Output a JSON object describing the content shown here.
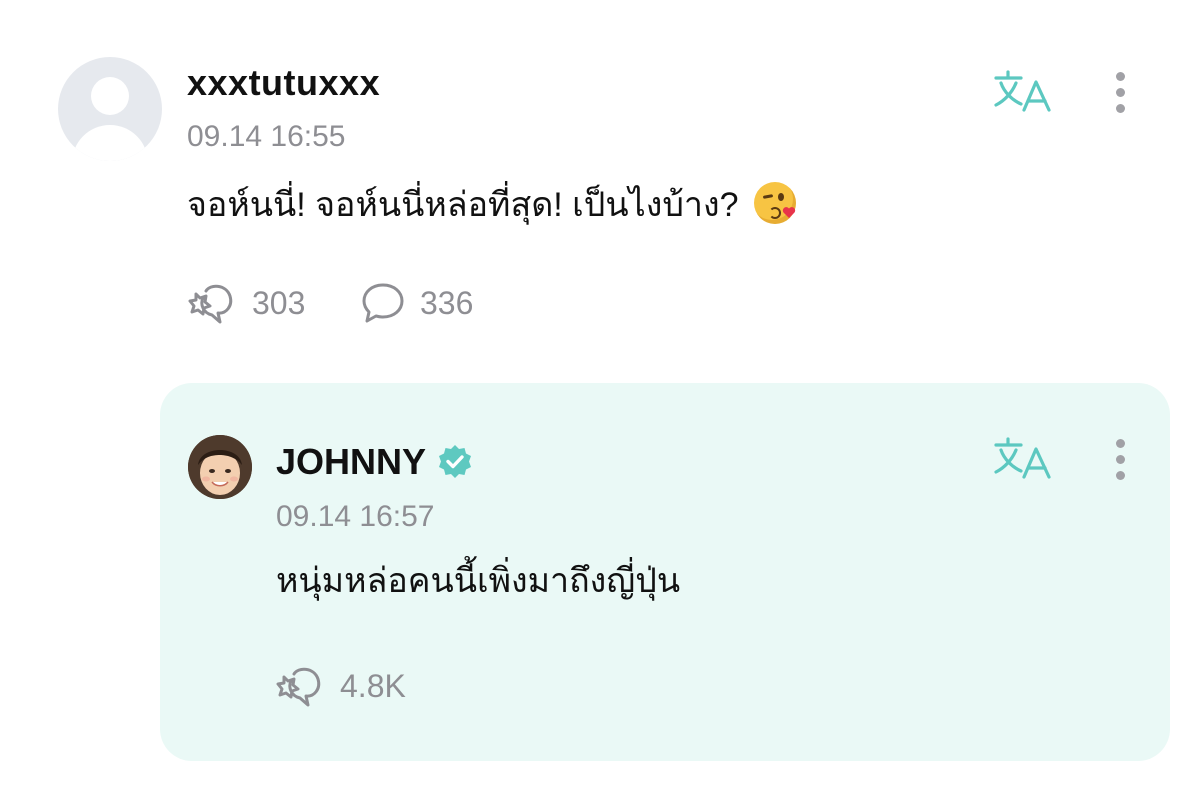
{
  "comment": {
    "username": "xxxtutuxxx",
    "timestamp": "09.14 16:55",
    "message": "จอห์นนี่! จอห์นนี่หล่อที่สุด! เป็นไงบ้าง?",
    "emoji": "face-blowing-a-kiss",
    "repost_count": "303",
    "reply_count": "336"
  },
  "reply": {
    "username": "JOHNNY",
    "verified": true,
    "timestamp": "09.14 16:57",
    "message": "หนุ่มหล่อคนนี้เพิ่งมาถึงญี่ปุ่น",
    "repost_count": "4.8K"
  },
  "colors": {
    "accent": "#5cc8c0",
    "muted": "#8e8e93",
    "reply_bg": "#eaf9f6",
    "verified": "#5ec9c0"
  }
}
